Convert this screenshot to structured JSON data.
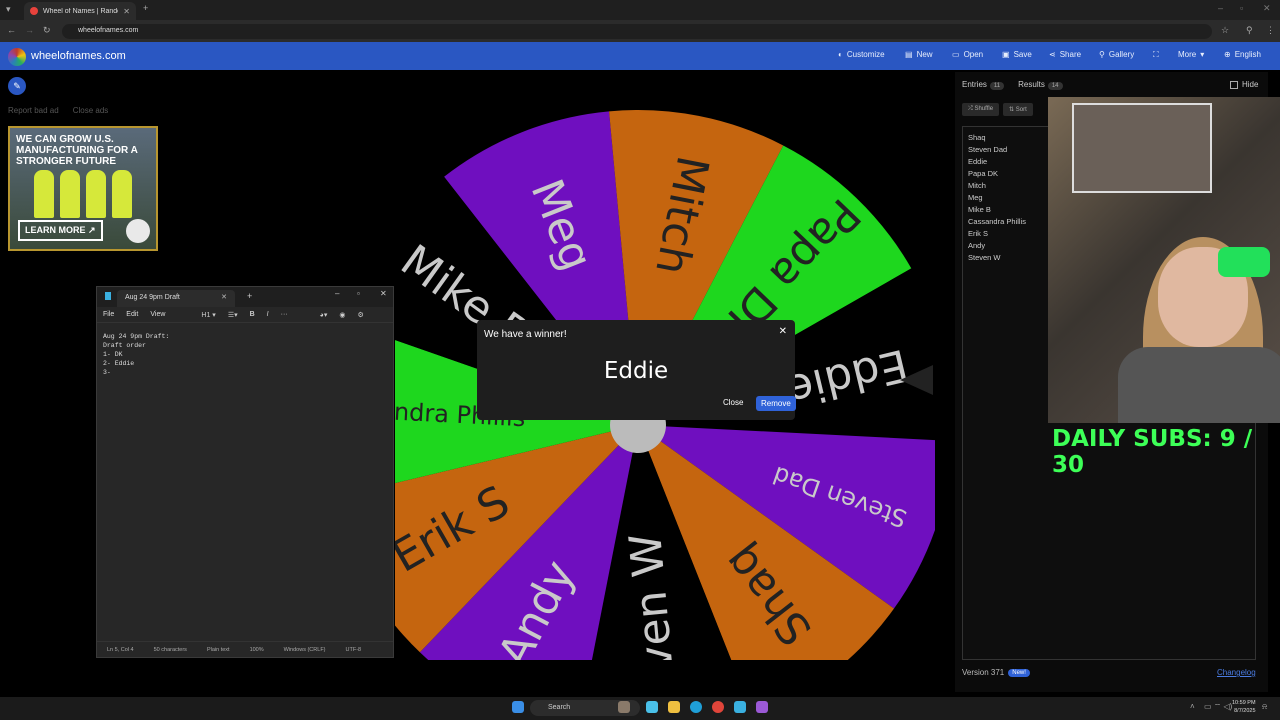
{
  "browser": {
    "tab_title": "Wheel of Names | Random nam",
    "url": "wheelofnames.com"
  },
  "header": {
    "brand": "wheelofnames.com",
    "menu": [
      "Customize",
      "New",
      "Open",
      "Save",
      "Share",
      "Gallery",
      "More",
      "English"
    ]
  },
  "ad": {
    "report": "Report bad ad",
    "close": "Close ads",
    "headline": "WE CAN GROW U.S. MANUFACTURING FOR A STRONGER FUTURE",
    "cta": "LEARN MORE"
  },
  "wheel": {
    "slices": [
      {
        "label": "Meg",
        "color": "#6f0fbf"
      },
      {
        "label": "Mitch",
        "color": "#c5650f"
      },
      {
        "label": "Papa DK",
        "color": "#1ed71e"
      },
      {
        "label": "Eddie",
        "color": "#000000"
      },
      {
        "label": "Steven Dad",
        "color": "#6f0fbf"
      },
      {
        "label": "Shaq",
        "color": "#c5650f"
      },
      {
        "label": "Steven W",
        "color": "#000000"
      },
      {
        "label": "Andy",
        "color": "#6f0fbf"
      },
      {
        "label": "Erik S",
        "color": "#c5650f"
      },
      {
        "label": "Cassandra Phillis",
        "color": "#1ed71e"
      },
      {
        "label": "Mike B",
        "color": "#000000"
      }
    ]
  },
  "notepad": {
    "tab_title": "Aug 24 9pm Draft",
    "menu": [
      "File",
      "Edit",
      "View"
    ],
    "heading_tool": "H1",
    "body": "Aug 24 9pm Draft:\nDraft order\n1- DK\n2- Eddie\n3-",
    "status": [
      "Ln 5, Col 4",
      "50 characters",
      "Plain text",
      "100%",
      "Windows (CRLF)",
      "UTF-8"
    ]
  },
  "modal": {
    "title": "We have a winner!",
    "winner": "Eddie",
    "close_label": "Close",
    "remove_label": "Remove"
  },
  "panel": {
    "tab_entries": "Entries",
    "entries_count": "11",
    "tab_results": "Results",
    "results_count": "14",
    "hide": "Hide",
    "shuffle": "Shuffle",
    "sort": "Sort",
    "entries": [
      "Shaq",
      "Steven Dad",
      "Eddie",
      "Papa DK",
      "Mitch",
      "Meg",
      "Mike B",
      "Cassandra Phillis",
      "Erik S",
      "Andy",
      "Steven W"
    ],
    "version": "Version 371",
    "new_badge": "New!",
    "changelog": "Changelog"
  },
  "stream": {
    "subs_text": "DAILY SUBS:  9 / 30"
  },
  "taskbar": {
    "search": "Search",
    "time": "10:59 PM",
    "date": "8/7/2025"
  }
}
